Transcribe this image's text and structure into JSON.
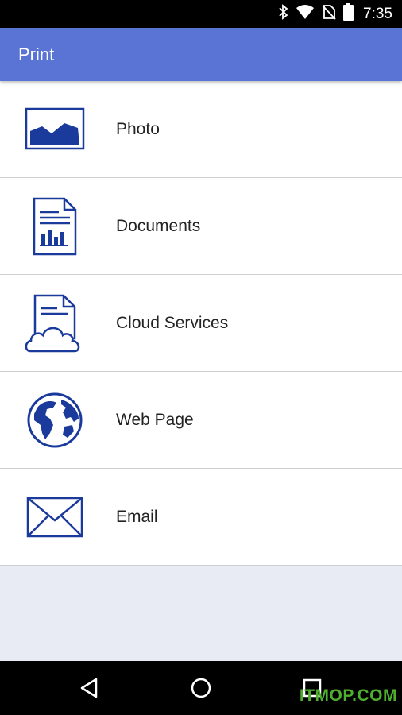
{
  "status_bar": {
    "time": "7:35",
    "icons": [
      "bluetooth-icon",
      "wifi-icon",
      "no-sim-icon",
      "battery-icon"
    ]
  },
  "app_bar": {
    "title": "Print",
    "color": "#5a74d6"
  },
  "menu": {
    "items": [
      {
        "label": "Photo",
        "icon": "photo-icon"
      },
      {
        "label": "Documents",
        "icon": "document-icon"
      },
      {
        "label": "Cloud Services",
        "icon": "cloud-document-icon"
      },
      {
        "label": "Web Page",
        "icon": "globe-icon"
      },
      {
        "label": "Email",
        "icon": "envelope-icon"
      }
    ]
  },
  "nav_bar": {
    "buttons": [
      "back-icon",
      "home-icon",
      "recents-icon"
    ]
  },
  "watermark": "ITMOP.COM",
  "colors": {
    "icon_blue": "#1a3a9c",
    "background": "#e8eaf4"
  }
}
